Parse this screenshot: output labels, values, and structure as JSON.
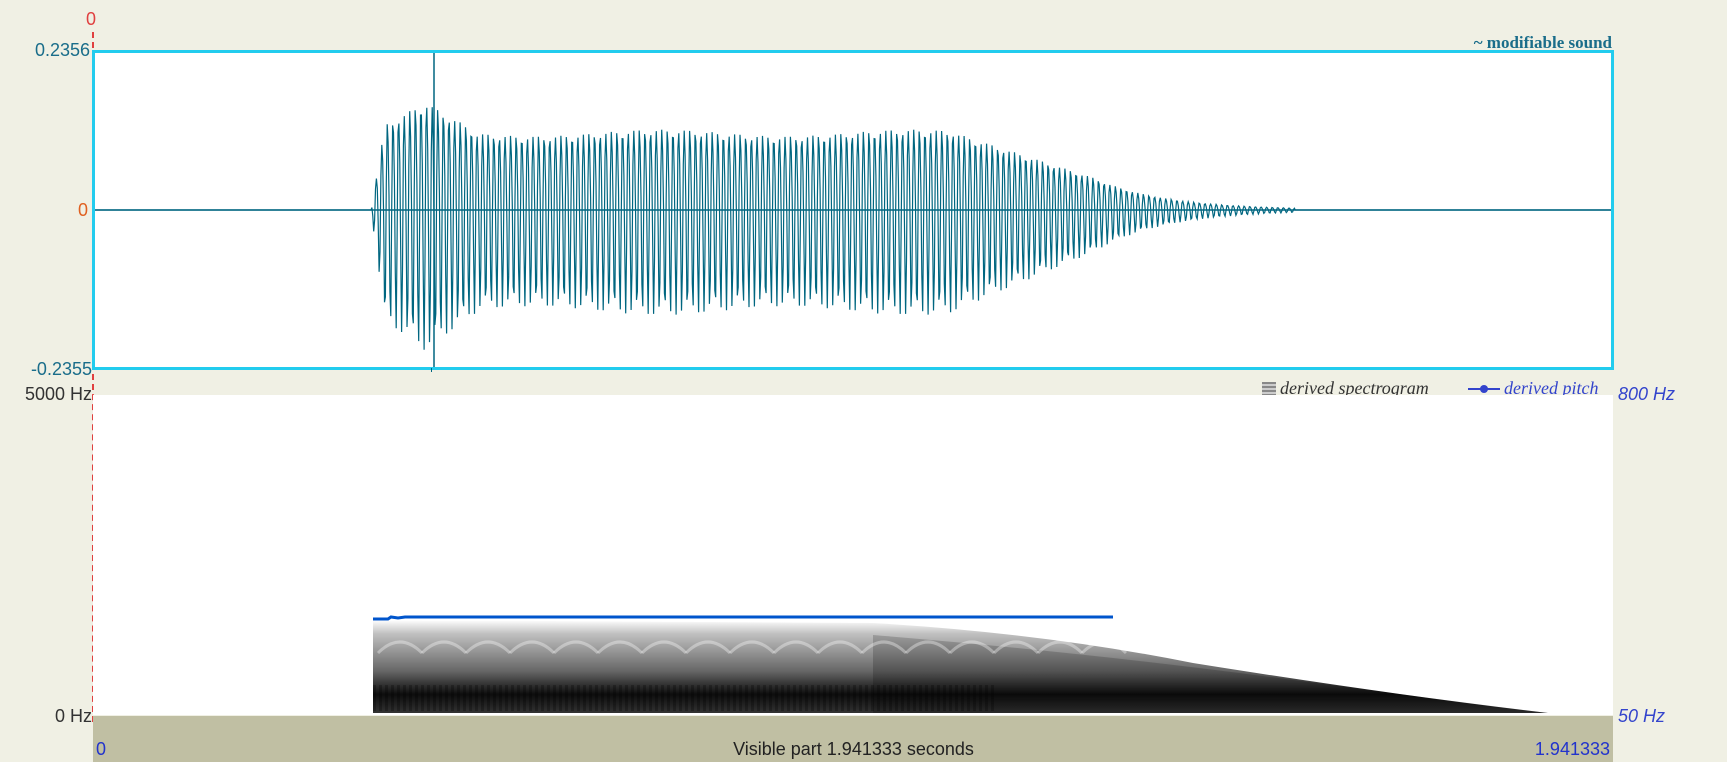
{
  "waveform": {
    "title": "~ modifiable sound",
    "y_max_label": "0.2356",
    "y_zero_label": "0",
    "y_min_label": "-0.2355",
    "cursor_time_label": "0",
    "wave_color": "#006680",
    "border_color": "#22ccee"
  },
  "spectrogram": {
    "freq_top_label": "5000 Hz",
    "freq_bottom_label": "0 Hz",
    "legend_spectrogram": "derived spectrogram",
    "legend_pitch": "derived pitch",
    "pitch_top_label": "800 Hz",
    "pitch_bottom_label": "50 Hz",
    "pitch_color": "#0055cc"
  },
  "time_axis": {
    "start_label": "0",
    "end_label": "1.941333",
    "visible_part_label": "Visible part 1.941333 seconds"
  },
  "cursor_color": "#e04040"
}
